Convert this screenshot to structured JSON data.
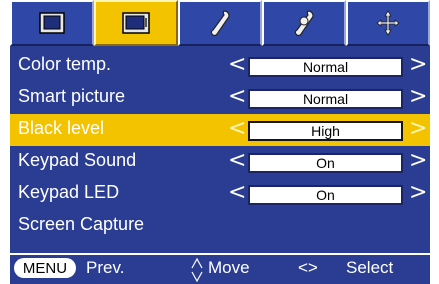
{
  "tabs": [
    {
      "name": "picture-tab",
      "icon": "picture-icon",
      "active": false
    },
    {
      "name": "screen-tab",
      "icon": "screen-icon",
      "active": true
    },
    {
      "name": "setup-tab-1",
      "icon": "wrench-icon",
      "active": false
    },
    {
      "name": "setup-tab-2",
      "icon": "wrench-icon",
      "active": false
    },
    {
      "name": "option-tab",
      "icon": "move-arrows-icon",
      "active": false
    }
  ],
  "menu": {
    "items": [
      {
        "label": "Color temp.",
        "value": "Normal"
      },
      {
        "label": "Smart picture",
        "value": "Normal"
      },
      {
        "label": "Black level",
        "value": "High",
        "highlighted": true
      },
      {
        "label": "Keypad Sound",
        "value": "On"
      },
      {
        "label": "Keypad LED",
        "value": "On"
      },
      {
        "label": "Screen Capture"
      }
    ],
    "left_arrow": "<",
    "right_arrow": ">"
  },
  "footer": {
    "menu_button": "MENU",
    "prev_label": "Prev.",
    "move_label": "Move",
    "select_arrows": "<>",
    "select_label": "Select"
  },
  "colors": {
    "background": "#2a3d93",
    "highlight": "#f3c300",
    "text": "#ffffff"
  }
}
